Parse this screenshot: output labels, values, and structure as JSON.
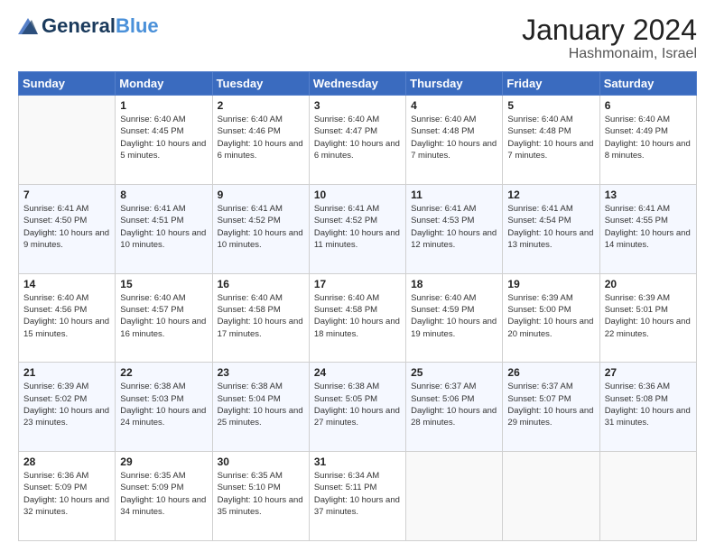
{
  "header": {
    "logo_general": "General",
    "logo_blue": "Blue",
    "month_year": "January 2024",
    "location": "Hashmonaim, Israel"
  },
  "weekdays": [
    "Sunday",
    "Monday",
    "Tuesday",
    "Wednesday",
    "Thursday",
    "Friday",
    "Saturday"
  ],
  "weeks": [
    [
      {
        "day": "",
        "sunrise": "",
        "sunset": "",
        "daylight": ""
      },
      {
        "day": "1",
        "sunrise": "Sunrise: 6:40 AM",
        "sunset": "Sunset: 4:45 PM",
        "daylight": "Daylight: 10 hours and 5 minutes."
      },
      {
        "day": "2",
        "sunrise": "Sunrise: 6:40 AM",
        "sunset": "Sunset: 4:46 PM",
        "daylight": "Daylight: 10 hours and 6 minutes."
      },
      {
        "day": "3",
        "sunrise": "Sunrise: 6:40 AM",
        "sunset": "Sunset: 4:47 PM",
        "daylight": "Daylight: 10 hours and 6 minutes."
      },
      {
        "day": "4",
        "sunrise": "Sunrise: 6:40 AM",
        "sunset": "Sunset: 4:48 PM",
        "daylight": "Daylight: 10 hours and 7 minutes."
      },
      {
        "day": "5",
        "sunrise": "Sunrise: 6:40 AM",
        "sunset": "Sunset: 4:48 PM",
        "daylight": "Daylight: 10 hours and 7 minutes."
      },
      {
        "day": "6",
        "sunrise": "Sunrise: 6:40 AM",
        "sunset": "Sunset: 4:49 PM",
        "daylight": "Daylight: 10 hours and 8 minutes."
      }
    ],
    [
      {
        "day": "7",
        "sunrise": "Sunrise: 6:41 AM",
        "sunset": "Sunset: 4:50 PM",
        "daylight": "Daylight: 10 hours and 9 minutes."
      },
      {
        "day": "8",
        "sunrise": "Sunrise: 6:41 AM",
        "sunset": "Sunset: 4:51 PM",
        "daylight": "Daylight: 10 hours and 10 minutes."
      },
      {
        "day": "9",
        "sunrise": "Sunrise: 6:41 AM",
        "sunset": "Sunset: 4:52 PM",
        "daylight": "Daylight: 10 hours and 10 minutes."
      },
      {
        "day": "10",
        "sunrise": "Sunrise: 6:41 AM",
        "sunset": "Sunset: 4:52 PM",
        "daylight": "Daylight: 10 hours and 11 minutes."
      },
      {
        "day": "11",
        "sunrise": "Sunrise: 6:41 AM",
        "sunset": "Sunset: 4:53 PM",
        "daylight": "Daylight: 10 hours and 12 minutes."
      },
      {
        "day": "12",
        "sunrise": "Sunrise: 6:41 AM",
        "sunset": "Sunset: 4:54 PM",
        "daylight": "Daylight: 10 hours and 13 minutes."
      },
      {
        "day": "13",
        "sunrise": "Sunrise: 6:41 AM",
        "sunset": "Sunset: 4:55 PM",
        "daylight": "Daylight: 10 hours and 14 minutes."
      }
    ],
    [
      {
        "day": "14",
        "sunrise": "Sunrise: 6:40 AM",
        "sunset": "Sunset: 4:56 PM",
        "daylight": "Daylight: 10 hours and 15 minutes."
      },
      {
        "day": "15",
        "sunrise": "Sunrise: 6:40 AM",
        "sunset": "Sunset: 4:57 PM",
        "daylight": "Daylight: 10 hours and 16 minutes."
      },
      {
        "day": "16",
        "sunrise": "Sunrise: 6:40 AM",
        "sunset": "Sunset: 4:58 PM",
        "daylight": "Daylight: 10 hours and 17 minutes."
      },
      {
        "day": "17",
        "sunrise": "Sunrise: 6:40 AM",
        "sunset": "Sunset: 4:58 PM",
        "daylight": "Daylight: 10 hours and 18 minutes."
      },
      {
        "day": "18",
        "sunrise": "Sunrise: 6:40 AM",
        "sunset": "Sunset: 4:59 PM",
        "daylight": "Daylight: 10 hours and 19 minutes."
      },
      {
        "day": "19",
        "sunrise": "Sunrise: 6:39 AM",
        "sunset": "Sunset: 5:00 PM",
        "daylight": "Daylight: 10 hours and 20 minutes."
      },
      {
        "day": "20",
        "sunrise": "Sunrise: 6:39 AM",
        "sunset": "Sunset: 5:01 PM",
        "daylight": "Daylight: 10 hours and 22 minutes."
      }
    ],
    [
      {
        "day": "21",
        "sunrise": "Sunrise: 6:39 AM",
        "sunset": "Sunset: 5:02 PM",
        "daylight": "Daylight: 10 hours and 23 minutes."
      },
      {
        "day": "22",
        "sunrise": "Sunrise: 6:38 AM",
        "sunset": "Sunset: 5:03 PM",
        "daylight": "Daylight: 10 hours and 24 minutes."
      },
      {
        "day": "23",
        "sunrise": "Sunrise: 6:38 AM",
        "sunset": "Sunset: 5:04 PM",
        "daylight": "Daylight: 10 hours and 25 minutes."
      },
      {
        "day": "24",
        "sunrise": "Sunrise: 6:38 AM",
        "sunset": "Sunset: 5:05 PM",
        "daylight": "Daylight: 10 hours and 27 minutes."
      },
      {
        "day": "25",
        "sunrise": "Sunrise: 6:37 AM",
        "sunset": "Sunset: 5:06 PM",
        "daylight": "Daylight: 10 hours and 28 minutes."
      },
      {
        "day": "26",
        "sunrise": "Sunrise: 6:37 AM",
        "sunset": "Sunset: 5:07 PM",
        "daylight": "Daylight: 10 hours and 29 minutes."
      },
      {
        "day": "27",
        "sunrise": "Sunrise: 6:36 AM",
        "sunset": "Sunset: 5:08 PM",
        "daylight": "Daylight: 10 hours and 31 minutes."
      }
    ],
    [
      {
        "day": "28",
        "sunrise": "Sunrise: 6:36 AM",
        "sunset": "Sunset: 5:09 PM",
        "daylight": "Daylight: 10 hours and 32 minutes."
      },
      {
        "day": "29",
        "sunrise": "Sunrise: 6:35 AM",
        "sunset": "Sunset: 5:09 PM",
        "daylight": "Daylight: 10 hours and 34 minutes."
      },
      {
        "day": "30",
        "sunrise": "Sunrise: 6:35 AM",
        "sunset": "Sunset: 5:10 PM",
        "daylight": "Daylight: 10 hours and 35 minutes."
      },
      {
        "day": "31",
        "sunrise": "Sunrise: 6:34 AM",
        "sunset": "Sunset: 5:11 PM",
        "daylight": "Daylight: 10 hours and 37 minutes."
      },
      {
        "day": "",
        "sunrise": "",
        "sunset": "",
        "daylight": ""
      },
      {
        "day": "",
        "sunrise": "",
        "sunset": "",
        "daylight": ""
      },
      {
        "day": "",
        "sunrise": "",
        "sunset": "",
        "daylight": ""
      }
    ]
  ]
}
